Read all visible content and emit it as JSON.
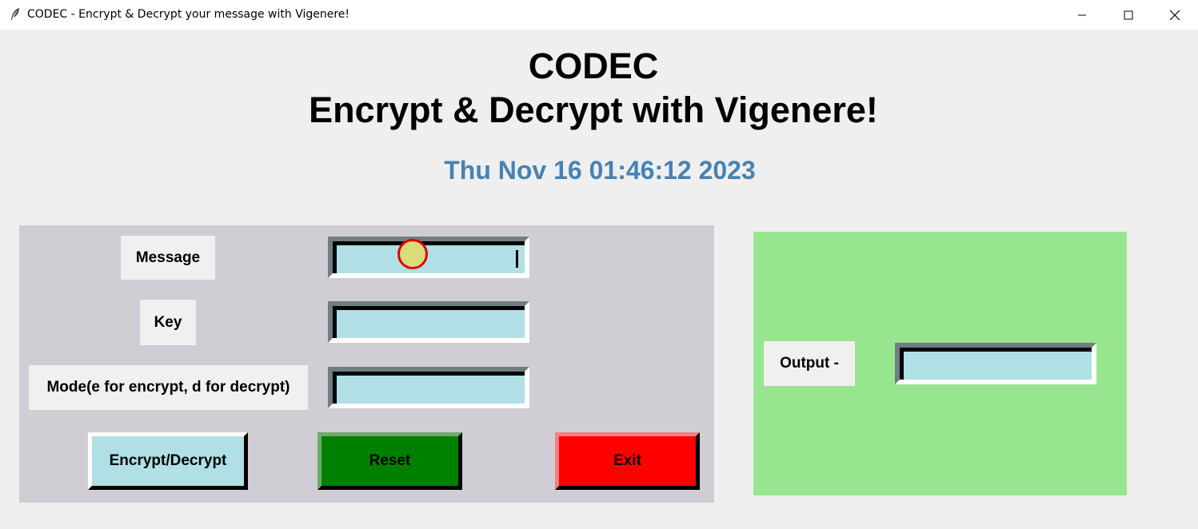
{
  "window": {
    "title": "CODEC - Encrypt & Decrypt your message with Vigenere!",
    "icon": "feather-icon",
    "controls": [
      "minimize-icon",
      "maximize-icon",
      "close-icon"
    ]
  },
  "header": {
    "title": "CODEC",
    "subtitle": "Encrypt & Decrypt with Vigenere!",
    "datetime": "Thu Nov 16 01:46:12 2023"
  },
  "form": {
    "message_label": "Message",
    "message_value": "",
    "key_label": "Key",
    "key_value": "",
    "mode_label": "Mode(e for encrypt, d for decrypt)",
    "mode_value": ""
  },
  "buttons": {
    "encrypt_decrypt": "Encrypt/Decrypt",
    "reset": "Reset",
    "exit": "Exit"
  },
  "output": {
    "label": "Output -",
    "value": ""
  },
  "colors": {
    "datetime": "#4682b4",
    "left_panel": "#d0cdd4",
    "right_panel": "#98e590",
    "entry_bg": "#b0e0e6",
    "encrypt_button": "#b0e0e6",
    "reset_button": "#008000",
    "exit_button": "#ff0000"
  }
}
